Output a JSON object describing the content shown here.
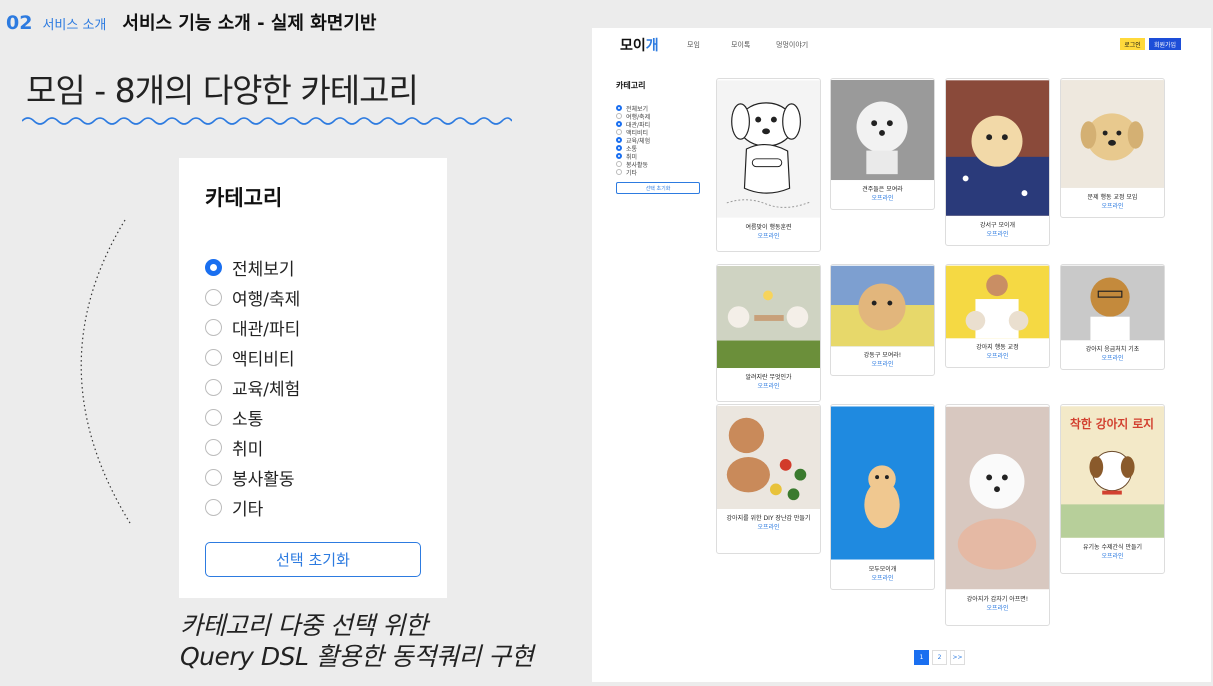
{
  "slide": {
    "section_number": "02",
    "section_name": "서비스 소개",
    "section_title": "서비스 기능 소개 - 실제 화면기반",
    "subtitle": "모임 - 8개의 다양한 카테고리",
    "note_line1": "카테고리 다중 선택 위한",
    "note_line2": "Query DSL 활용한 동적쿼리 구현"
  },
  "zoom_panel": {
    "title": "카테고리",
    "items": [
      {
        "label": "전체보기",
        "checked": true
      },
      {
        "label": "여행/축제",
        "checked": false
      },
      {
        "label": "대관/파티",
        "checked": false
      },
      {
        "label": "액티비티",
        "checked": false
      },
      {
        "label": "교육/체험",
        "checked": false
      },
      {
        "label": "소통",
        "checked": false
      },
      {
        "label": "취미",
        "checked": false
      },
      {
        "label": "봉사활동",
        "checked": false
      },
      {
        "label": "기타",
        "checked": false
      }
    ],
    "reset_label": "선택 초기화"
  },
  "site": {
    "logo_main": "모이",
    "logo_accent": "개",
    "nav": [
      "모임",
      "모이톡",
      "멍멍이야기"
    ],
    "login_label": "로그인",
    "join_label": "회원가입",
    "sidebar": {
      "title": "카테고리",
      "items": [
        {
          "label": "전체보기",
          "checked": true
        },
        {
          "label": "여행/축제",
          "checked": false
        },
        {
          "label": "대관/파티",
          "checked": true
        },
        {
          "label": "액티비티",
          "checked": false
        },
        {
          "label": "교육/체험",
          "checked": true
        },
        {
          "label": "소통",
          "checked": true
        },
        {
          "label": "취미",
          "checked": true
        },
        {
          "label": "봉사활동",
          "checked": false
        },
        {
          "label": "기타",
          "checked": false
        }
      ],
      "reset_label": "선택 초기화"
    },
    "cards": [
      {
        "title": "여름맞이 행동훈련",
        "sub": "오프라인",
        "bg": "#f4f4f4"
      },
      {
        "title": "견주들은 모여라",
        "sub": "오프라인",
        "bg": "#9a9a9a"
      },
      {
        "title": "강서구 모이개",
        "sub": "오프라인",
        "bg": "#8a4a3a"
      },
      {
        "title": "문제 행동 교정 모임",
        "sub": "오프라인",
        "bg": "#eee8de"
      },
      {
        "title": "알려지란 무엇인가",
        "sub": "오프라인",
        "bg": "#cfd3c2"
      },
      {
        "title": "강동구 모여라!",
        "sub": "오프라인",
        "bg": "#7d9fd0"
      },
      {
        "title": "강아지 행동 교정",
        "sub": "오프라인",
        "bg": "#f5d943"
      },
      {
        "title": "강아지 응급처치 기초",
        "sub": "오프라인",
        "bg": "#c9c9c9"
      },
      {
        "title": "강아지를 위한 DIY 장난감 만들기",
        "sub": "오프라인",
        "bg": "#ebe6df"
      },
      {
        "title": "모두모이개",
        "sub": "오프라인",
        "bg": "#1f8ae0"
      },
      {
        "title": "강아지가 갑자기 아프면!",
        "sub": "오프라인",
        "bg": "#d8c8c0"
      },
      {
        "title": "유기농 수제간식 만들기",
        "sub": "오프라인",
        "bg": "#f3e9c8",
        "poster_text": "착한 강아지 로지"
      }
    ],
    "pages": [
      "1",
      "2",
      ">>"
    ]
  }
}
